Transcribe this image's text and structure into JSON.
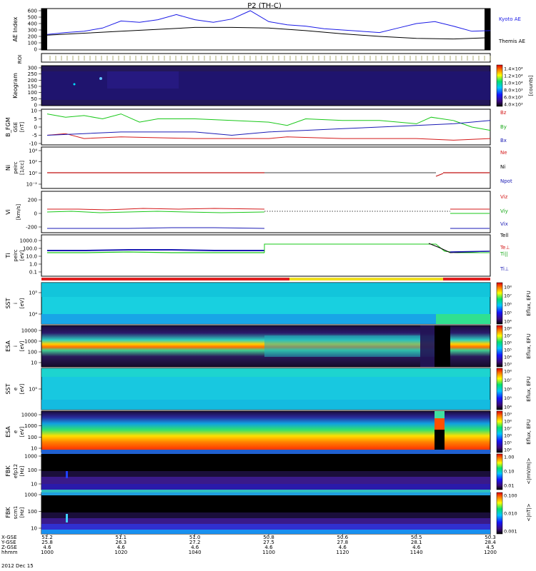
{
  "title": "P2 (TH-C)",
  "date_label": "2012 Dec 15",
  "colors": {
    "kyoto": "#1a1ae6",
    "themis": "#000000",
    "bz": "#d41a1a",
    "by": "#18c818",
    "bx": "#1a1ab4"
  },
  "x_axis": {
    "row_labels": [
      "X-GSE",
      "Y-GSE",
      "Z-GSE",
      "hhmm"
    ],
    "ticks": [
      {
        "hhmm": "1000",
        "x": "51.2",
        "y": "25.8",
        "z": "4.6"
      },
      {
        "hhmm": "1020",
        "x": "51.1",
        "y": "26.3",
        "z": "4.6"
      },
      {
        "hhmm": "1040",
        "x": "51.0",
        "y": "27.2",
        "z": "4.6"
      },
      {
        "hhmm": "1100",
        "x": "50.8",
        "y": "27.5",
        "z": "4.6"
      },
      {
        "hhmm": "1120",
        "x": "50.6",
        "y": "27.8",
        "z": "4.6"
      },
      {
        "hhmm": "1140",
        "x": "50.5",
        "y": "28.1",
        "z": "4.6"
      },
      {
        "hhmm": "1200",
        "x": "50.3",
        "y": "28.4",
        "z": "4.5"
      }
    ]
  },
  "panels": {
    "ae": {
      "ylabel": "AE Index",
      "yticks": [
        "600",
        "500",
        "400",
        "300",
        "200",
        "100",
        "0"
      ],
      "legend": [
        "Kyoto AE",
        "Themis AE"
      ]
    },
    "roi": {
      "ylabel": "ROI"
    },
    "keogram": {
      "ylabel": "Keogram",
      "yticks": [
        "300",
        "250",
        "200",
        "150",
        "100",
        "50",
        "0"
      ],
      "cbar_ticks": [
        "1.4×10⁴",
        "1.2×10⁴",
        "1.0×10⁴",
        "8.0×10³",
        "6.0×10³",
        "4.0×10³"
      ],
      "cbar_label": "[counts]"
    },
    "bfgm": {
      "ylabel": "B_FGM",
      "sub1": "GSE",
      "sub2": "[nT]",
      "yticks": [
        "10",
        "5",
        "0",
        "-5",
        "-10"
      ],
      "legend": [
        "Bz",
        "By",
        "Bx"
      ]
    },
    "ni": {
      "ylabel": "Ni",
      "sub1": "peirc",
      "sub2": "[1/cc]",
      "yticks": [
        "10⁴",
        "10²",
        "10⁰",
        "10⁻²"
      ],
      "legend": [
        "Ne",
        "Ni",
        "Npot"
      ]
    },
    "vi": {
      "ylabel": "Vi",
      "sub2": "[km/s]",
      "yticks": [
        "200",
        "0",
        "-200"
      ],
      "legend": [
        "Viz",
        "Viy",
        "Vix"
      ]
    },
    "ti": {
      "ylabel": "Ti",
      "sub1": "peirc",
      "sub2": "[eV]",
      "yticks": [
        "1000.0",
        "100.0",
        "10.0",
        "1.0",
        "0.1"
      ],
      "legend": [
        "Tell",
        "Te⊥",
        "Ti||",
        "Ti⊥"
      ]
    },
    "sst_i": {
      "ylabel": "SST",
      "sub1": "i",
      "sub2": "[eV]",
      "yticks": [
        "10⁵",
        "10⁴"
      ],
      "cbar_ticks": [
        "10⁸",
        "10⁷",
        "10⁶",
        "10⁵",
        "10⁴"
      ],
      "cbar_label": "Eflux, EFU"
    },
    "esa_i": {
      "ylabel": "ESA",
      "sub1": "i",
      "sub2": "[eV]",
      "yticks": [
        "10000",
        "1000",
        "100",
        "10"
      ],
      "cbar_ticks": [
        "10⁸",
        "10⁷",
        "10⁶",
        "10⁵",
        "10⁴",
        "10³"
      ],
      "cbar_label": "Eflux, EFU"
    },
    "sst_e": {
      "ylabel": "SST",
      "sub1": "e",
      "sub2": "[eV]",
      "yticks": [
        "10⁵"
      ],
      "cbar_ticks": [
        "10⁸",
        "10⁷",
        "10⁶",
        "10⁵",
        "10⁴"
      ],
      "cbar_label": "Eflux, EFU"
    },
    "esa_e": {
      "ylabel": "ESA",
      "sub1": "e",
      "sub2": "[eV]",
      "yticks": [
        "10000",
        "1000",
        "100",
        "10"
      ],
      "cbar_ticks": [
        "10⁹",
        "10⁸",
        "10⁷",
        "10⁶",
        "10⁵",
        "10⁴"
      ],
      "cbar_label": "Eflux, EFU"
    },
    "fbk1": {
      "ylabel": "FBK",
      "sub1": "efp12",
      "sub2": "[Hz]",
      "yticks": [
        "1000",
        "100",
        "10"
      ],
      "cbar_ticks": [
        "1.00",
        "0.10",
        "0.01"
      ],
      "cbar_label": "<|mV/m|>"
    },
    "fbk2": {
      "ylabel": "FBK",
      "sub1": "scm1",
      "sub2": "[Hz]",
      "yticks": [
        "1000",
        "100",
        "10"
      ],
      "cbar_ticks": [
        "0.100",
        "0.010",
        "0.001"
      ],
      "cbar_label": "<|nT|>"
    }
  },
  "chart_data": {
    "type": "line",
    "title": "P2 (TH-C)",
    "x_unit": "hhmm (UT), 2012 Dec 15",
    "x_range": [
      "1000",
      "1200"
    ],
    "ae_series": [
      {
        "name": "Kyoto AE",
        "t": [
          0,
          5,
          10,
          15,
          20,
          25,
          30,
          35,
          40,
          45,
          50,
          55,
          60,
          65,
          70,
          75,
          80,
          85,
          90,
          95,
          100,
          105,
          110,
          115,
          120
        ],
        "values": [
          230,
          260,
          280,
          330,
          440,
          420,
          460,
          540,
          460,
          420,
          470,
          600,
          430,
          380,
          360,
          320,
          300,
          280,
          260,
          330,
          400,
          430,
          360,
          280,
          290
        ]
      },
      {
        "name": "Themis AE",
        "t": [
          0,
          10,
          20,
          30,
          40,
          50,
          60,
          70,
          80,
          90,
          100,
          110,
          120
        ],
        "values": [
          220,
          250,
          280,
          310,
          340,
          340,
          330,
          290,
          240,
          200,
          170,
          160,
          180
        ]
      }
    ],
    "ae_ylim": [
      0,
      600
    ],
    "b_series": [
      {
        "name": "Bz",
        "t": [
          0,
          5,
          10,
          20,
          40,
          60,
          65,
          80,
          100,
          110,
          120
        ],
        "values": [
          -5,
          -4,
          -7,
          -6,
          -7,
          -7,
          -6,
          -7,
          -7,
          -8,
          -7
        ]
      },
      {
        "name": "By",
        "t": [
          0,
          5,
          10,
          15,
          20,
          25,
          30,
          40,
          50,
          60,
          65,
          70,
          80,
          90,
          100,
          104,
          110,
          115,
          120
        ],
        "values": [
          8,
          6,
          7,
          5,
          8,
          3,
          5,
          5,
          4,
          3,
          1,
          5,
          4,
          4,
          2,
          6,
          4,
          0,
          -2
        ]
      },
      {
        "name": "Bx",
        "t": [
          0,
          10,
          20,
          30,
          40,
          50,
          60,
          70,
          80,
          90,
          100,
          110,
          120
        ],
        "values": [
          -5,
          -4,
          -3,
          -3,
          -3,
          -5,
          -3,
          -2,
          -1,
          0,
          1,
          2,
          4
        ]
      }
    ],
    "b_ylim": [
      -10,
      10
    ],
    "gap_interval_hhmm": [
      "1100",
      "1142"
    ]
  }
}
